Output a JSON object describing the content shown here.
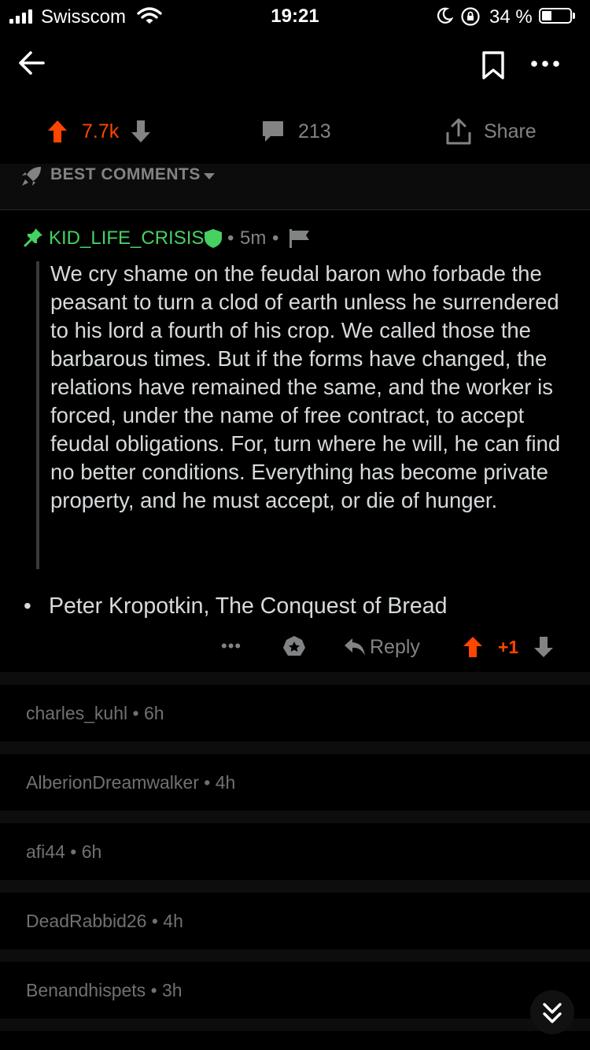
{
  "status_bar": {
    "carrier": "Swisscom",
    "time": "19:21",
    "battery": "34 %",
    "battery_level": 0.34
  },
  "nav": {
    "back_icon": "arrow-left-icon",
    "bookmark_icon": "bookmark-icon",
    "more_icon": "more-horizontal-icon"
  },
  "post_actions": {
    "score": "7.7k",
    "comments": "213",
    "share_label": "Share",
    "upvote_color": "#ff4500"
  },
  "sort": {
    "label": "BEST COMMENTS",
    "icon": "rocket-icon"
  },
  "comment": {
    "author": "KID_LIFE_CRISIS",
    "separator": "•",
    "time": "5m",
    "author_color": "#46d160",
    "quote": "We cry shame on the feudal baron who forbade the peasant to turn a clod of earth unless he surrendered to his lord a fourth of his crop. We called those the barbarous times. But if the forms have changed, the relations have remained the same, and the worker is forced, under the name of free contract, to accept feudal obligations. For, turn where he will, he can find no better conditions. Everything has become private property, and he must accept, or die of hunger.",
    "bullet": "•",
    "citation": "Peter Kropotkin, The Conquest of Bread",
    "more_label": "•••",
    "reply_label": "Reply",
    "score": "+1"
  },
  "collapsed_comments": [
    {
      "text": "charles_kuhl • 6h"
    },
    {
      "text": "AlberionDreamwalker • 4h"
    },
    {
      "text": "afi44 • 6h"
    },
    {
      "text": "DeadRabbid26 • 4h"
    },
    {
      "text": "Benandhispets • 3h"
    }
  ]
}
